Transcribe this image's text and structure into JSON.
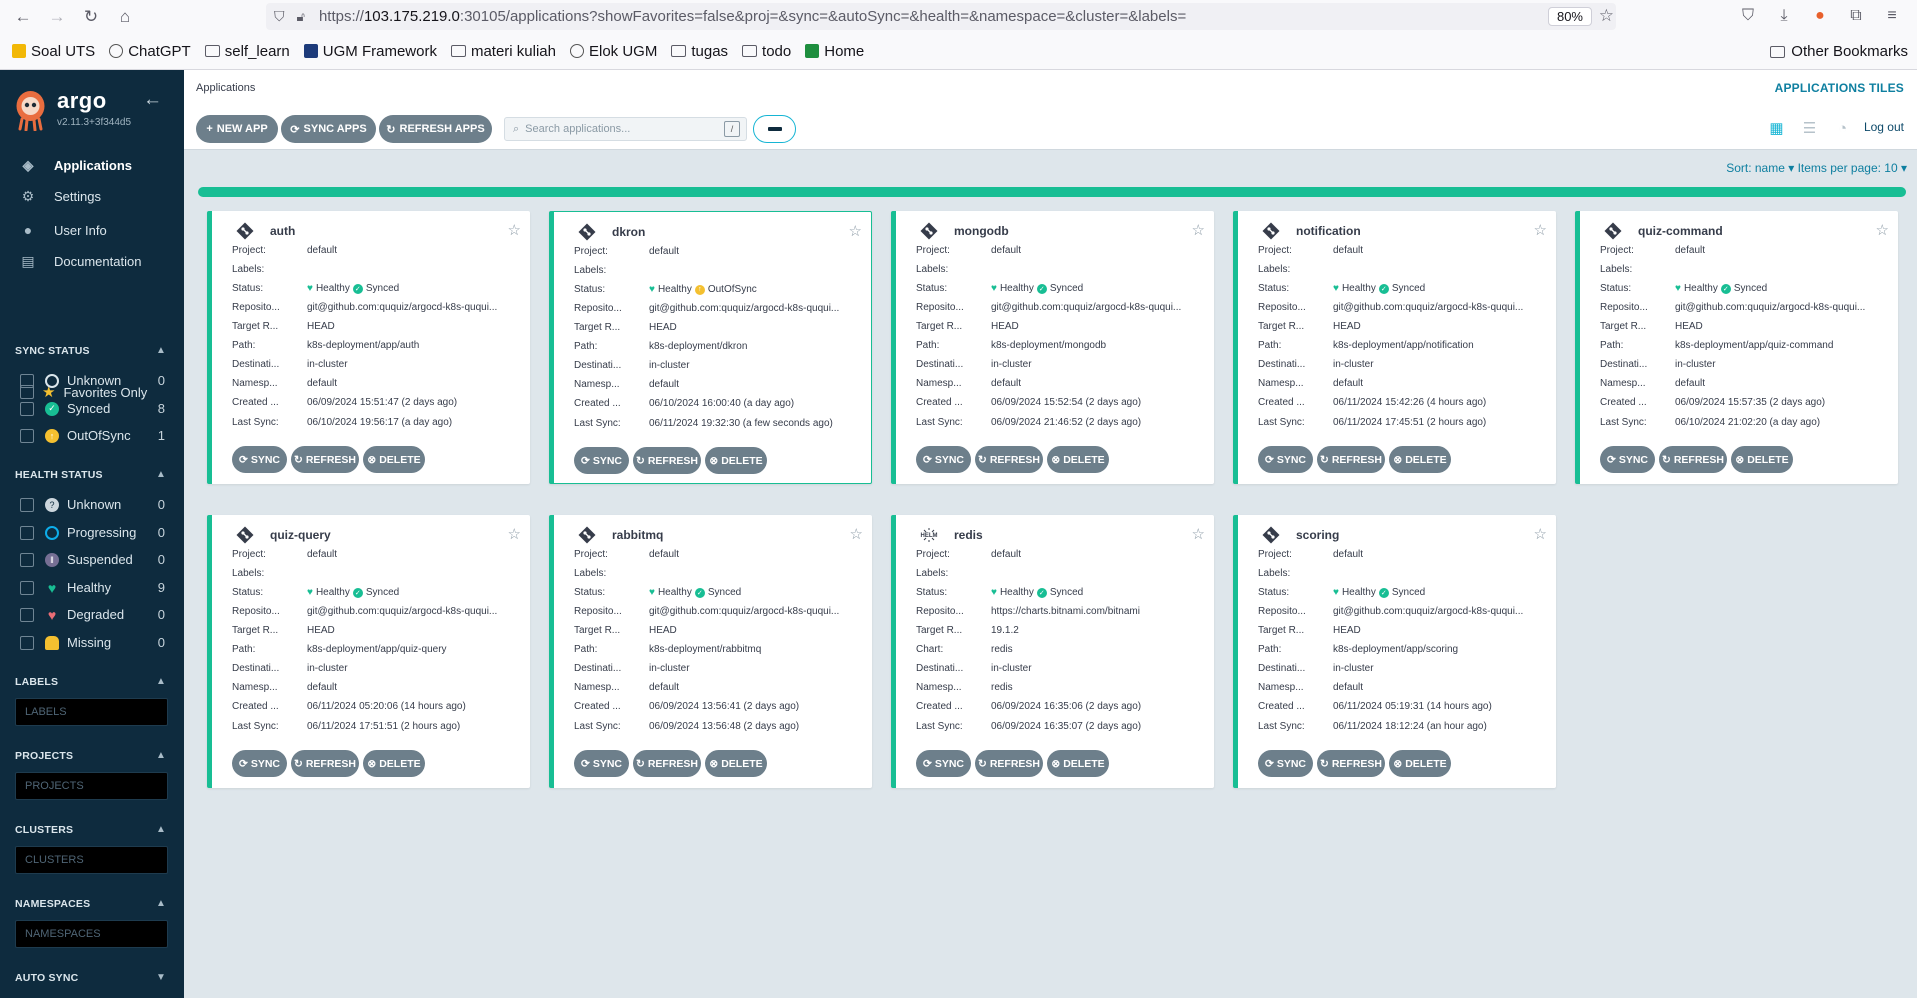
{
  "browser": {
    "url_prefix": "https://",
    "url_host": "103.175.219.0",
    "url_rest": ":30105/applications?showFavorites=false&proj=&sync=&autoSync=&health=&namespace=&cluster=&labels=",
    "zoom": "80%",
    "bookmarks": [
      "Soal UTS",
      "ChatGPT",
      "self_learn",
      "UGM Framework",
      "materi kuliah",
      "Elok UGM",
      "tugas",
      "todo",
      "Home"
    ],
    "other_bookmarks": "Other Bookmarks"
  },
  "sidebar": {
    "logo_text": "argo",
    "version": "v2.11.3+3f344d5",
    "nav": [
      "Applications",
      "Settings",
      "User Info",
      "Documentation"
    ],
    "favorites_label": "Favorites Only",
    "sync_status": {
      "title": "SYNC STATUS",
      "items": [
        {
          "label": "Unknown",
          "count": "0"
        },
        {
          "label": "Synced",
          "count": "8"
        },
        {
          "label": "OutOfSync",
          "count": "1"
        }
      ]
    },
    "health_status": {
      "title": "HEALTH STATUS",
      "items": [
        {
          "label": "Unknown",
          "count": "0"
        },
        {
          "label": "Progressing",
          "count": "0"
        },
        {
          "label": "Suspended",
          "count": "0"
        },
        {
          "label": "Healthy",
          "count": "9"
        },
        {
          "label": "Degraded",
          "count": "0"
        },
        {
          "label": "Missing",
          "count": "0"
        }
      ]
    },
    "labels": {
      "title": "LABELS",
      "placeholder": "LABELS"
    },
    "projects": {
      "title": "PROJECTS",
      "placeholder": "PROJECTS"
    },
    "clusters": {
      "title": "CLUSTERS",
      "placeholder": "CLUSTERS"
    },
    "namespaces": {
      "title": "NAMESPACES",
      "placeholder": "NAMESPACES"
    },
    "auto_sync": {
      "title": "AUTO SYNC"
    }
  },
  "header": {
    "breadcrumb": "Applications",
    "title": "APPLICATIONS TILES",
    "new_app": "NEW APP",
    "sync_apps": "SYNC APPS",
    "refresh_apps": "REFRESH APPS",
    "search_placeholder": "Search applications...",
    "search_key": "/",
    "logout": "Log out",
    "sort": "Sort: name ▾ Items per page: 10 ▾"
  },
  "card_labels": {
    "project": "Project:",
    "labels": "Labels:",
    "status": "Status:",
    "repo": "Reposito...",
    "target": "Target R...",
    "path": "Path:",
    "chart": "Chart:",
    "dest": "Destinati...",
    "ns": "Namesp...",
    "created": "Created ...",
    "last_sync": "Last Sync:",
    "sync_btn": "SYNC",
    "refresh_btn": "REFRESH",
    "delete_btn": "DELETE",
    "healthy": "Healthy"
  },
  "apps": [
    {
      "name": "auth",
      "project": "default",
      "sync": "Synced",
      "repo": "git@github.com:ququiz/argocd-k8s-ququi...",
      "target": "HEAD",
      "path": "k8s-deployment/app/auth",
      "dest": "in-cluster",
      "ns": "default",
      "created": "06/09/2024 15:51:47  (2 days ago)",
      "last_sync": "06/10/2024 19:56:17  (a day ago)"
    },
    {
      "name": "dkron",
      "project": "default",
      "sync": "OutOfSync",
      "repo": "git@github.com:ququiz/argocd-k8s-ququi...",
      "target": "HEAD",
      "path": "k8s-deployment/dkron",
      "dest": "in-cluster",
      "ns": "default",
      "created": "06/10/2024 16:00:40  (a day ago)",
      "last_sync": "06/11/2024 19:32:30  (a few seconds ago)"
    },
    {
      "name": "mongodb",
      "project": "default",
      "sync": "Synced",
      "repo": "git@github.com:ququiz/argocd-k8s-ququi...",
      "target": "HEAD",
      "path": "k8s-deployment/mongodb",
      "dest": "in-cluster",
      "ns": "default",
      "created": "06/09/2024 15:52:54  (2 days ago)",
      "last_sync": "06/09/2024 21:46:52  (2 days ago)"
    },
    {
      "name": "notification",
      "project": "default",
      "sync": "Synced",
      "repo": "git@github.com:ququiz/argocd-k8s-ququi...",
      "target": "HEAD",
      "path": "k8s-deployment/app/notification",
      "dest": "in-cluster",
      "ns": "default",
      "created": "06/11/2024 15:42:26  (4 hours ago)",
      "last_sync": "06/11/2024 17:45:51  (2 hours ago)"
    },
    {
      "name": "quiz-command",
      "project": "default",
      "sync": "Synced",
      "repo": "git@github.com:ququiz/argocd-k8s-ququi...",
      "target": "HEAD",
      "path": "k8s-deployment/app/quiz-command",
      "dest": "in-cluster",
      "ns": "default",
      "created": "06/09/2024 15:57:35  (2 days ago)",
      "last_sync": "06/10/2024 21:02:20  (a day ago)"
    },
    {
      "name": "quiz-query",
      "project": "default",
      "sync": "Synced",
      "repo": "git@github.com:ququiz/argocd-k8s-ququi...",
      "target": "HEAD",
      "path": "k8s-deployment/app/quiz-query",
      "dest": "in-cluster",
      "ns": "default",
      "created": "06/11/2024 05:20:06  (14 hours ago)",
      "last_sync": "06/11/2024 17:51:51  (2 hours ago)"
    },
    {
      "name": "rabbitmq",
      "project": "default",
      "sync": "Synced",
      "repo": "git@github.com:ququiz/argocd-k8s-ququi...",
      "target": "HEAD",
      "path": "k8s-deployment/rabbitmq",
      "dest": "in-cluster",
      "ns": "default",
      "created": "06/09/2024 13:56:41  (2 days ago)",
      "last_sync": "06/09/2024 13:56:48  (2 days ago)"
    },
    {
      "name": "redis",
      "project": "default",
      "sync": "Synced",
      "repo": "https://charts.bitnami.com/bitnami",
      "target": "19.1.2",
      "path": "redis",
      "dest": "in-cluster",
      "ns": "redis",
      "created": "06/09/2024 16:35:06  (2 days ago)",
      "last_sync": "06/09/2024 16:35:07  (2 days ago)",
      "helm": true
    },
    {
      "name": "scoring",
      "project": "default",
      "sync": "Synced",
      "repo": "git@github.com:ququiz/argocd-k8s-ququi...",
      "target": "HEAD",
      "path": "k8s-deployment/app/scoring",
      "dest": "in-cluster",
      "ns": "default",
      "created": "06/11/2024 05:19:31  (14 hours ago)",
      "last_sync": "06/11/2024 18:12:24  (an hour ago)"
    }
  ]
}
